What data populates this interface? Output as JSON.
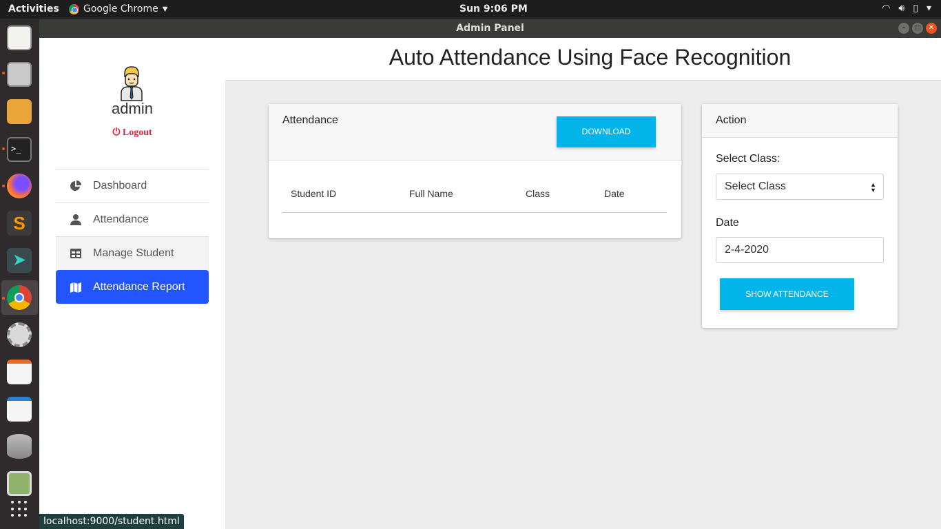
{
  "system": {
    "activities": "Activities",
    "app_name": "Google Chrome",
    "clock": "Sun  9:06 PM"
  },
  "window": {
    "title": "Admin Panel"
  },
  "sidebar": {
    "user": "admin",
    "logout": "Logout",
    "items": [
      {
        "label": "Dashboard",
        "icon": "pie-chart-icon"
      },
      {
        "label": "Attendance",
        "icon": "user-icon"
      },
      {
        "label": "Manage Student",
        "icon": "table-icon"
      },
      {
        "label": "Attendance Report",
        "icon": "map-icon",
        "active": true
      }
    ]
  },
  "header": {
    "title": "Auto Attendance Using Face Recognition"
  },
  "attendance_card": {
    "title": "Attendance",
    "download_label": "DOWNLOAD",
    "columns": [
      "Student ID",
      "Full Name",
      "Class",
      "Date"
    ]
  },
  "action_card": {
    "title": "Action",
    "class_label": "Select Class:",
    "class_value": "Select Class",
    "date_label": "Date",
    "date_value": "2-4-2020",
    "show_label": "SHOW ATTENDANCE"
  },
  "status_url": "localhost:9000/student.html",
  "colors": {
    "accent_blue": "#2255ff",
    "button_cyan": "#03b4ea",
    "logout_red": "#e8213f"
  }
}
